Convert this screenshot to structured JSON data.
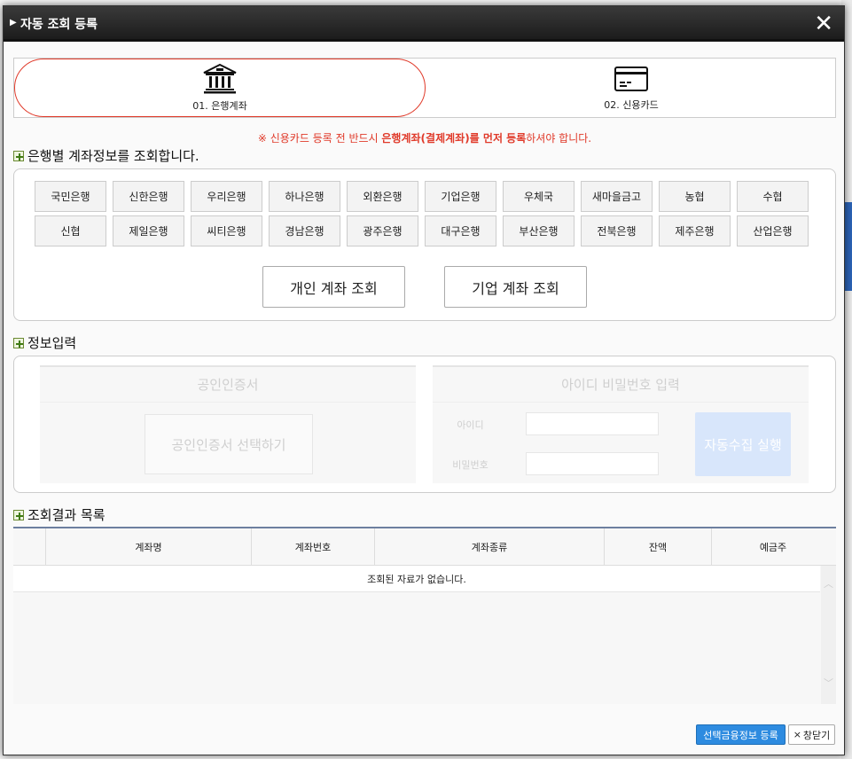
{
  "modal": {
    "title": "자동 조회 등록",
    "close_symbol": "✕"
  },
  "tabs": [
    {
      "label": "01. 은행계좌",
      "icon": "bank-icon"
    },
    {
      "label": "02. 신용카드",
      "icon": "credit-card-icon"
    }
  ],
  "notice": {
    "prefix": "※ 신용카드 등록 전 반드시 ",
    "highlight": "은행계좌(결제계좌)를 먼저 등록",
    "suffix": "하셔야 합니다."
  },
  "bank_section": {
    "title": "은행별 계좌정보를 조회합니다.",
    "banks": [
      "국민은행",
      "신한은행",
      "우리은행",
      "하나은행",
      "외환은행",
      "기업은행",
      "우체국",
      "새마을금고",
      "농협",
      "수협",
      "신협",
      "제일은행",
      "씨티은행",
      "경남은행",
      "광주은행",
      "대구은행",
      "부산은행",
      "전북은행",
      "제주은행",
      "산업은행"
    ],
    "personal_btn": "개인 계좌 조회",
    "business_btn": "기업 계좌 조회"
  },
  "info_section": {
    "title": "정보입력",
    "cert_header": "공인인증서",
    "cert_btn": "공인인증서 선택하기",
    "id_header": "아이디 비밀번호 입력",
    "id_label": "아이디",
    "pw_label": "비밀번호",
    "run_btn": "자동수집 실행"
  },
  "result_section": {
    "title": "조회결과 목록",
    "columns": [
      "계좌명",
      "계좌번호",
      "계좌종류",
      "잔액",
      "예금주"
    ],
    "empty_text": "조회된 자료가 없습니다."
  },
  "footer": {
    "register_btn": "선택금융정보 등록",
    "close_btn": "창닫기",
    "close_symbol": "×"
  },
  "colors": {
    "accent_red": "#e03a2a",
    "primary_blue": "#2d8be0"
  }
}
